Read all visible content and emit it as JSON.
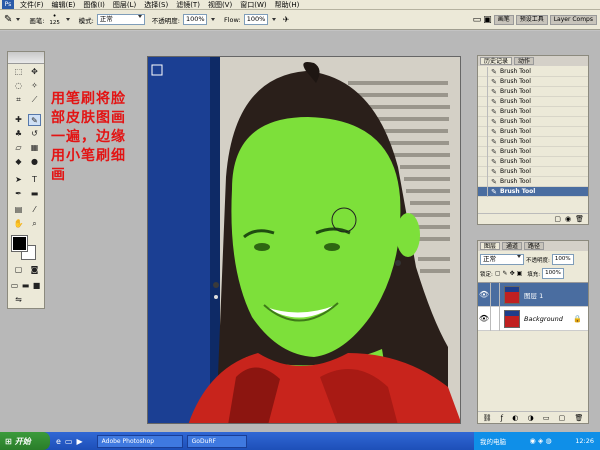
{
  "menu": {
    "items": [
      "文件(F)",
      "编辑(E)",
      "图像(I)",
      "图层(L)",
      "选择(S)",
      "滤镜(T)",
      "视图(V)",
      "窗口(W)",
      "帮助(H)"
    ]
  },
  "options": {
    "brush_label": "画笔:",
    "brush_size": "125",
    "mode_label": "模式:",
    "mode_value": "正常",
    "opacity_label": "不透明度:",
    "opacity_value": "100%",
    "flow_label": "Flow:",
    "flow_value": "100%",
    "dock_tabs": [
      "画笔",
      "预设工具",
      "Layer Comps"
    ]
  },
  "annotation": {
    "lines": [
      "用笔刷将脸",
      "部皮肤图画",
      "一遍，边缘",
      "用小笔刷细",
      "画"
    ]
  },
  "history": {
    "tabs": [
      "历史记录",
      "动作"
    ],
    "items": [
      "Brush Tool",
      "Brush Tool",
      "Brush Tool",
      "Brush Tool",
      "Brush Tool",
      "Brush Tool",
      "Brush Tool",
      "Brush Tool",
      "Brush Tool",
      "Brush Tool",
      "Brush Tool",
      "Brush Tool",
      "Brush Tool"
    ]
  },
  "layers": {
    "tabs": [
      "图层",
      "通道",
      "路径"
    ],
    "mode": "正常",
    "opacity_label": "不透明度:",
    "opacity_value": "100%",
    "lock_label": "锁定:",
    "fill_label": "填充:",
    "fill_value": "100%",
    "items": [
      {
        "name": "图层 1",
        "selected": true
      },
      {
        "name": "Background",
        "selected": false
      }
    ]
  },
  "taskbar": {
    "start_label": "开始",
    "tasks": [
      "Adobe Photoshop",
      "GoDuRF"
    ],
    "tray_label": "我的电脑",
    "clock": "12:26"
  },
  "colors": {
    "annotation": "#e31414",
    "skin_overlay": "#7de03a",
    "jacket": "#c8241c",
    "backdrop_blue": "#1b3f93",
    "history_selected": "#4a6da0"
  }
}
